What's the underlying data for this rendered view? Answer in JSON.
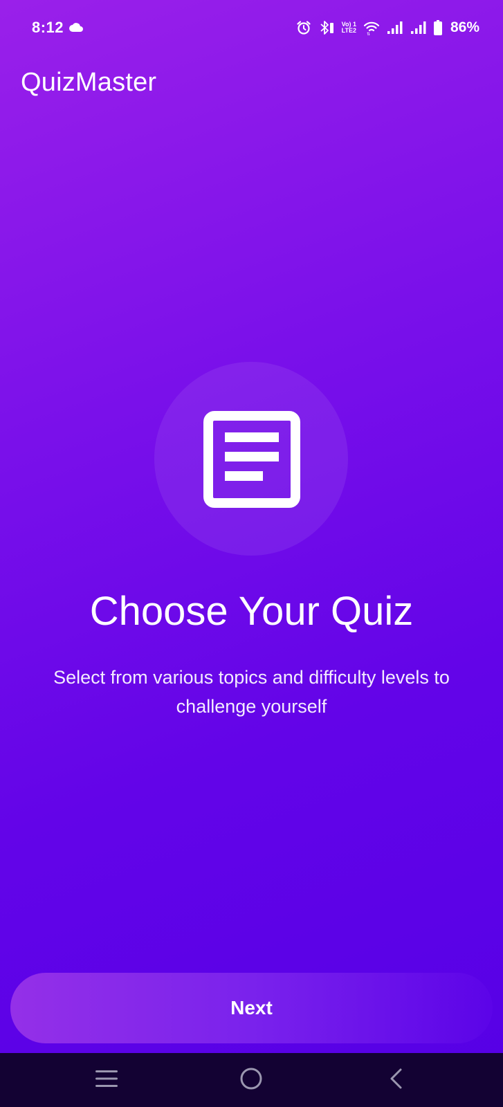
{
  "status_bar": {
    "time": "8:12",
    "battery": "86%",
    "volte_line1": "Vo) 1",
    "volte_line2": "LTE2",
    "icons": [
      "cloud-icon",
      "alarm-icon",
      "bluetooth-icon",
      "volte-icon",
      "wifi-icon",
      "signal-icon",
      "signal-icon",
      "battery-icon"
    ]
  },
  "app": {
    "title": "QuizMaster"
  },
  "onboarding": {
    "illustration_icon": "document-icon",
    "headline": "Choose Your Quiz",
    "subtitle": "Select from various topics and difficulty levels to challenge yourself"
  },
  "actions": {
    "next_label": "Next"
  },
  "nav_bar": {
    "buttons": [
      "recents-icon",
      "home-icon",
      "back-icon"
    ]
  },
  "colors": {
    "gradient_top": "#9a20ea",
    "gradient_bottom": "#5500e6",
    "nav_background": "#130233",
    "text": "#ffffff"
  }
}
